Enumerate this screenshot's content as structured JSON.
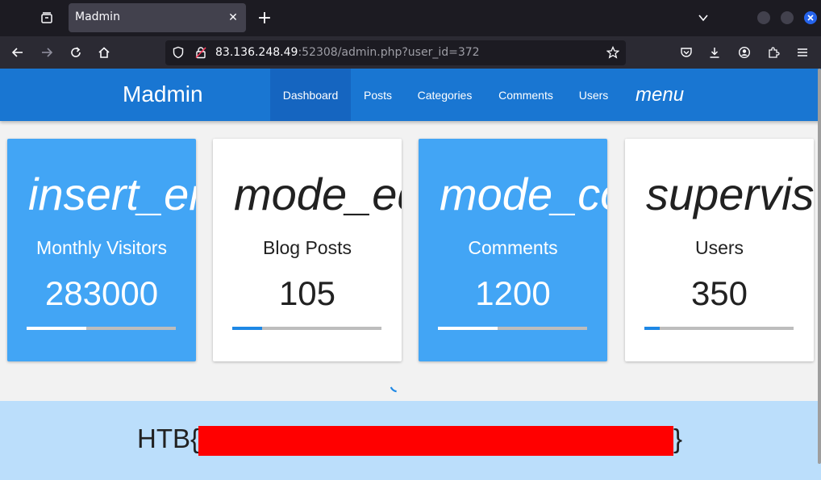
{
  "browser": {
    "tab": {
      "title": "Madmin"
    },
    "url": {
      "host": "83.136.248.49",
      "rest": ":52308/admin.php?user_id=372"
    }
  },
  "app": {
    "brand": "Madmin",
    "nav": [
      {
        "label": "Dashboard",
        "active": true
      },
      {
        "label": "Posts"
      },
      {
        "label": "Categories"
      },
      {
        "label": "Comments"
      },
      {
        "label": "Users"
      }
    ],
    "menu_label": "menu"
  },
  "cards": [
    {
      "icon_text": "insert_emoticon",
      "label": "Monthly Visitors",
      "value": "283000",
      "progress_percent": 40,
      "style": "blue"
    },
    {
      "icon_text": "mode_edit",
      "label": "Blog Posts",
      "value": "105",
      "progress_percent": 20,
      "style": "white"
    },
    {
      "icon_text": "mode_comment",
      "label": "Comments",
      "value": "1200",
      "progress_percent": 40,
      "style": "blue"
    },
    {
      "icon_text": "supervisor_account",
      "label": "Users",
      "value": "350",
      "progress_percent": 10,
      "style": "white"
    }
  ],
  "flag": {
    "prefix": "HTB{",
    "suffix": "}"
  },
  "colors": {
    "header": "#1976d2",
    "active_nav": "#1565c0",
    "card_blue": "#42a5f5",
    "progress_accent": "#1e88e5",
    "flag_bg": "#bbdefb",
    "redaction": "#ff0000"
  }
}
